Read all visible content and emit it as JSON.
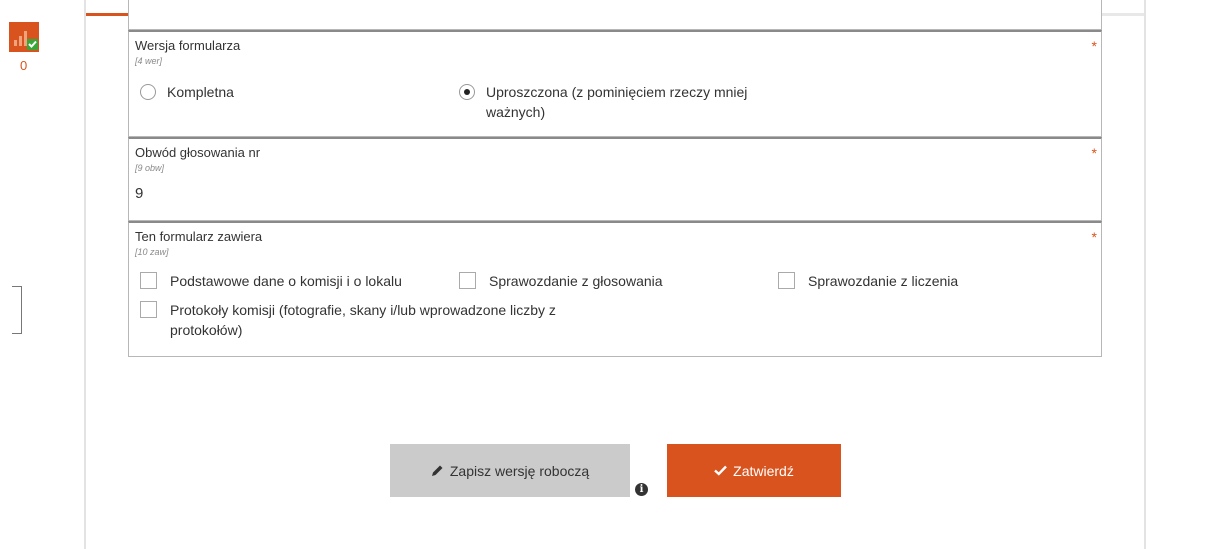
{
  "progress": {
    "fraction": 0.915
  },
  "sidebar": {
    "count": "0",
    "icon": "stats-check-icon"
  },
  "form": {
    "version": {
      "title": "Wersja formularza",
      "hint": "[4 wer]",
      "required": "*",
      "options": [
        {
          "label": "Kompletna",
          "checked": false
        },
        {
          "label": "Uproszczona (z pominięciem rzeczy mniej ważnych)",
          "checked": true
        }
      ]
    },
    "district": {
      "title": "Obwód głosowania nr",
      "hint": "[9 obw]",
      "required": "*",
      "value": "9"
    },
    "contains": {
      "title": "Ten formularz zawiera",
      "hint": "[10 zaw]",
      "required": "*",
      "options": [
        {
          "label": "Podstawowe dane o komisji i o lokalu",
          "checked": false
        },
        {
          "label": "Sprawozdanie z głosowania",
          "checked": false
        },
        {
          "label": "Sprawozdanie z liczenia",
          "checked": false
        },
        {
          "label": "Protokoły komisji (fotografie, skany i/lub wprowadzone liczby z protokołów)",
          "checked": false
        }
      ]
    }
  },
  "actions": {
    "draft_label": "Zapisz wersję roboczą",
    "draft_icon": "pencil-icon",
    "submit_label": "Zatwierdź",
    "submit_icon": "check-icon",
    "info_icon": "info-icon",
    "accent": "#d9531e"
  }
}
